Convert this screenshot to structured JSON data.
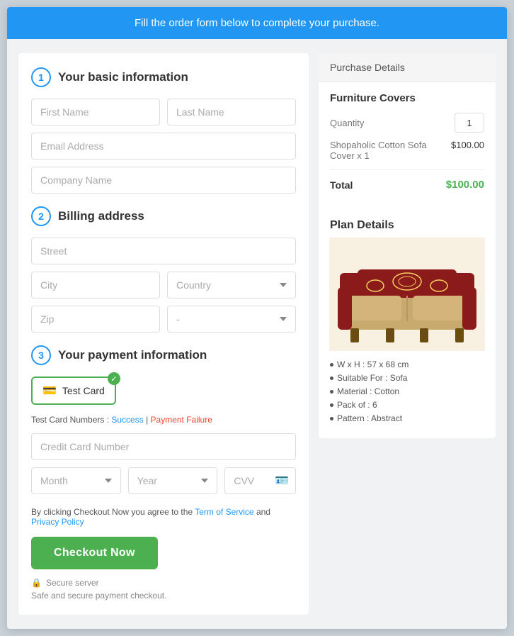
{
  "banner": {
    "text": "Fill the order form below to complete your purchase."
  },
  "form": {
    "section1_title": "Your basic information",
    "section1_number": "1",
    "section2_title": "Billing address",
    "section2_number": "2",
    "section3_title": "Your payment information",
    "section3_number": "3",
    "first_name_placeholder": "First Name",
    "last_name_placeholder": "Last Name",
    "email_placeholder": "Email Address",
    "company_placeholder": "Company Name",
    "street_placeholder": "Street",
    "city_placeholder": "City",
    "country_placeholder": "Country",
    "zip_placeholder": "Zip",
    "state_placeholder": "-",
    "card_label": "Test Card",
    "test_card_prefix": "Test Card Numbers : ",
    "test_card_success": "Success",
    "test_card_separator": " | ",
    "test_card_failure": "Payment Failure",
    "cc_number_placeholder": "Credit Card Number",
    "month_placeholder": "Month",
    "year_placeholder": "Year",
    "cvv_placeholder": "CVV",
    "agree_prefix": "By clicking Checkout Now you agree to the ",
    "agree_tos": "Term of Service",
    "agree_middle": " and ",
    "agree_privacy": "Privacy Policy",
    "checkout_label": "Checkout Now",
    "secure_label": "Secure server",
    "secure_desc": "Safe and secure payment checkout."
  },
  "purchase": {
    "header": "Purchase Details",
    "product_title": "Furniture Covers",
    "quantity_label": "Quantity",
    "quantity_value": "1",
    "item_name": "Shopaholic Cotton Sofa Cover x 1",
    "item_price": "$100.00",
    "total_label": "Total",
    "total_price": "$100.00",
    "plan_title": "Plan Details",
    "features": [
      "W x H : 57 x 68 cm",
      "Suitable For : Sofa",
      "Material : Cotton",
      "Pack of : 6",
      "Pattern : Abstract"
    ]
  },
  "colors": {
    "blue": "#2196f3",
    "green": "#4caf50",
    "red": "#f44336"
  }
}
